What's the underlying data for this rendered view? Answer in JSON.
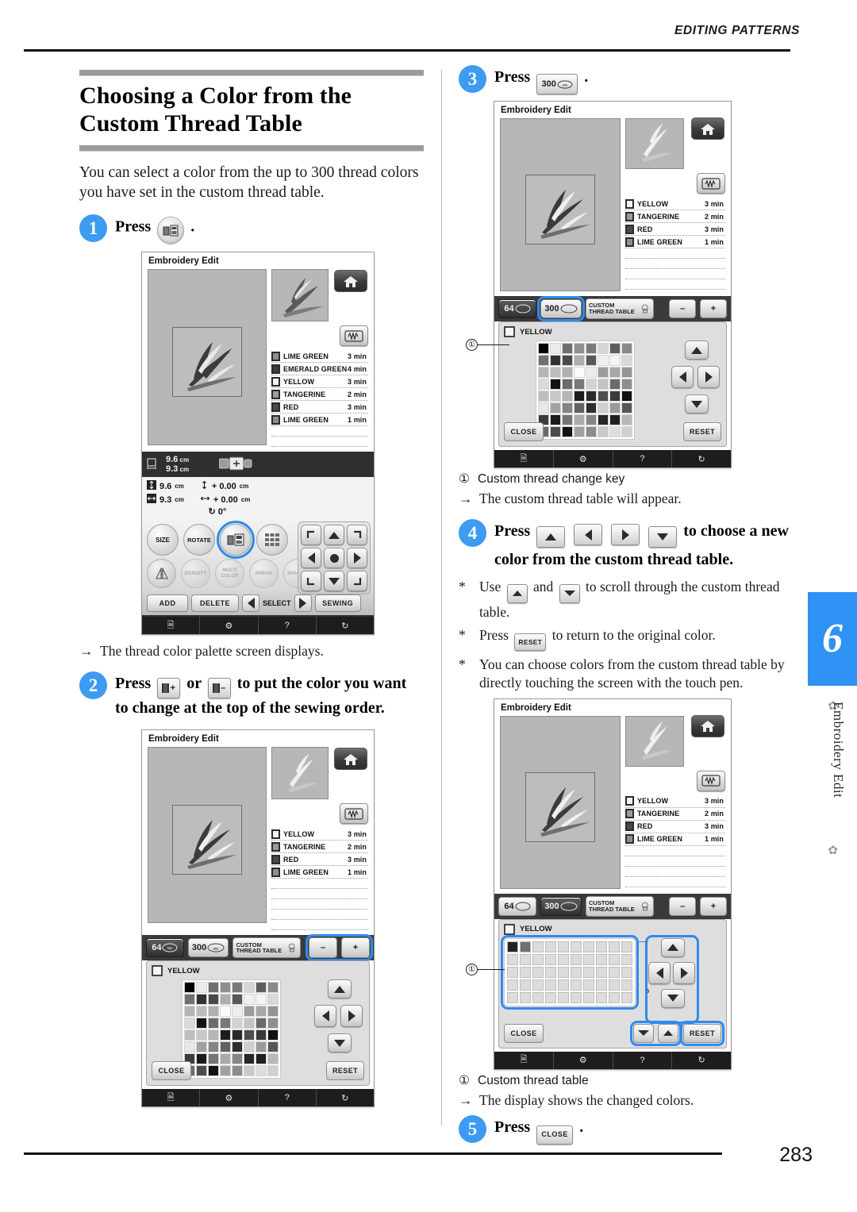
{
  "header": {
    "running_head": "EDITING PATTERNS"
  },
  "footer": {
    "page_number": "283"
  },
  "chapter_tab": {
    "number": "6",
    "label": "Embroidery Edit"
  },
  "section": {
    "title_line1": "Choosing a Color from the",
    "title_line2": "Custom Thread Table",
    "intro": "You can select a color from the up to 300 thread colors you have set in the custom thread table."
  },
  "steps": [
    {
      "num": "1",
      "text_before": "Press",
      "key": "thread-color-palette-key",
      "text_after": ".",
      "result": "The thread color palette screen displays.",
      "result_mark": "→"
    },
    {
      "num": "2",
      "line1_a": "Press",
      "key_a": "Ⅱ+",
      "line1_b": "or",
      "key_b": "Ⅱ-",
      "line1_c": "to put the color you want",
      "line2": "to change at the top of the sewing order."
    },
    {
      "num": "3",
      "text_before": "Press",
      "key": "300",
      "text_after": ".",
      "callout_label": "Custom thread change key",
      "callout_num": "①",
      "result_mark": "→",
      "result": "The custom thread table will appear."
    },
    {
      "num": "4",
      "line1_a": "Press",
      "line1_b": "to choose a new",
      "line2": "color from the custom thread table.",
      "notes": [
        {
          "mark": "*",
          "a": "Use",
          "b": "and",
          "c": "to scroll through the custom thread table."
        },
        {
          "mark": "*",
          "a": "Press",
          "key": "RESET",
          "c": "to return to the original color."
        },
        {
          "mark": "*",
          "a": "You can choose colors from the custom thread table by directly touching the screen with the touch pen."
        }
      ],
      "callout_num": "①",
      "callout_label": "Custom thread table",
      "result_mark": "→",
      "result": "The display shows the changed colors."
    },
    {
      "num": "5",
      "text_before": "Press",
      "key": "CLOSE",
      "text_after": "."
    }
  ],
  "screens": {
    "screen1": {
      "title": "Embroidery Edit",
      "home_icon": "home-icon",
      "sewing_icon": "sewing-preview-icon",
      "threads": [
        {
          "name": "LIME GREEN",
          "time": "3 min",
          "swatch": "#8e8e8e"
        },
        {
          "name": "EMERALD GREEN",
          "time": "4 min",
          "swatch": "#3a3a3a"
        },
        {
          "name": "YELLOW",
          "time": "3 min",
          "swatch": "#f2f2f2"
        },
        {
          "name": "TANGERINE",
          "time": "2 min",
          "swatch": "#9b9b9b"
        },
        {
          "name": "RED",
          "time": "3 min",
          "swatch": "#4a4a4a"
        },
        {
          "name": "LIME GREEN",
          "time": "1 min",
          "swatch": "#8e8e8e"
        }
      ],
      "size": {
        "w_label": "9.6",
        "h_label": "9.3",
        "unit": "cm",
        "size_w": "9.6",
        "size_h": "9.3",
        "offset_v": "+ 0.00",
        "offset_h": "+ 0.00",
        "rotation": "0°"
      },
      "func_buttons": [
        "SIZE",
        "ROTATE",
        "",
        ""
      ],
      "func_buttons2": [
        "",
        "DENSITY",
        "MULTI COLOR",
        "ARRAY",
        "SPACING",
        ""
      ],
      "action_buttons": [
        "ADD",
        "DELETE",
        "SELECT",
        "SEWING"
      ],
      "bottom_icons": [
        "manual-icon",
        "machine-icon",
        "help-icon",
        "needle-icon"
      ]
    },
    "screen2": {
      "title": "Embroidery Edit",
      "threads": [
        {
          "name": "YELLOW",
          "time": "3 min",
          "swatch": "#f2f2f2"
        },
        {
          "name": "TANGERINE",
          "time": "2 min",
          "swatch": "#9b9b9b"
        },
        {
          "name": "RED",
          "time": "3 min",
          "swatch": "#4a4a4a"
        },
        {
          "name": "LIME GREEN",
          "time": "1 min",
          "swatch": "#8e8e8e"
        }
      ],
      "palette_buttons": [
        "64",
        "300",
        "CUSTOM THREAD TABLE"
      ],
      "order_buttons": [
        "Ⅱ-",
        "Ⅱ+"
      ],
      "selected_color": "YELLOW",
      "close_label": "CLOSE",
      "reset_label": "RESET"
    },
    "screen3": {
      "title": "Embroidery Edit",
      "threads": [
        {
          "name": "YELLOW",
          "time": "3 min",
          "swatch": "#f2f2f2"
        },
        {
          "name": "TANGERINE",
          "time": "2 min",
          "swatch": "#9b9b9b"
        },
        {
          "name": "RED",
          "time": "3 min",
          "swatch": "#4a4a4a"
        },
        {
          "name": "LIME GREEN",
          "time": "1 min",
          "swatch": "#8e8e8e"
        }
      ],
      "palette_buttons": [
        "64",
        "300",
        "CUSTOM THREAD TABLE"
      ],
      "order_buttons": [
        "Ⅱ-",
        "Ⅱ+"
      ],
      "selected_color": "YELLOW",
      "close_label": "CLOSE",
      "reset_label": "RESET"
    },
    "screen4": {
      "title": "Embroidery Edit",
      "threads": [
        {
          "name": "YELLOW",
          "time": "3 min",
          "swatch": "#f2f2f2"
        },
        {
          "name": "TANGERINE",
          "time": "2 min",
          "swatch": "#9b9b9b"
        },
        {
          "name": "RED",
          "time": "3 min",
          "swatch": "#4a4a4a"
        },
        {
          "name": "LIME GREEN",
          "time": "1 min",
          "swatch": "#8e8e8e"
        }
      ],
      "palette_buttons": [
        "64",
        "300",
        "CUSTOM THREAD TABLE"
      ],
      "order_buttons": [
        "Ⅱ-",
        "Ⅱ+"
      ],
      "selected_color": "YELLOW",
      "close_label": "CLOSE",
      "reset_label": "RESET",
      "scroll_index": "5"
    }
  },
  "palette_grid": {
    "rows": 8,
    "cols": 8,
    "colors": [
      "#050505",
      "#ececec",
      "#6f6f6f",
      "#909090",
      "#7a7a7a",
      "#d6d6d6",
      "#5e5e5e",
      "#8a8a8a",
      "#717171",
      "#323232",
      "#4a4a4a",
      "#aeaeae",
      "#585858",
      "#f0f0f0",
      "#f4f4f4",
      "#d8d8d8",
      "#b4b4b4",
      "#bcbcbc",
      "#b0b0b0",
      "#fbfbfb",
      "#ededed",
      "#9c9c9c",
      "#a8a8a8",
      "#949494",
      "#dadada",
      "#141414",
      "#6c6c6c",
      "#787878",
      "#d2d2d2",
      "#c4c4c4",
      "#6a6a6a",
      "#8e8e8e",
      "#bebebe",
      "#c8c8c8",
      "#b6b6b6",
      "#1c1c1c",
      "#2a2a2a",
      "#4e4e4e",
      "#3a3a3a",
      "#101010",
      "#e8e8e8",
      "#a2a2a2",
      "#848484",
      "#626262",
      "#2e2e2e",
      "#cfcfcf",
      "#9a9a9a",
      "#565656",
      "#3c3c3c",
      "#1a1a1a",
      "#747474",
      "#aaaaaa",
      "#868686",
      "#262626",
      "#1f1f1f",
      "#b8b8b8",
      "#6b6b6b",
      "#4c4c4c",
      "#121212",
      "#a0a0a0",
      "#8c8c8c",
      "#c9c9c9",
      "#dddddd",
      "#d0d0d0"
    ]
  },
  "custom_grid": {
    "rows": 5,
    "cols": 10,
    "filled": [
      "#232323",
      "#707070"
    ],
    "empty": "#dcdcdc"
  }
}
